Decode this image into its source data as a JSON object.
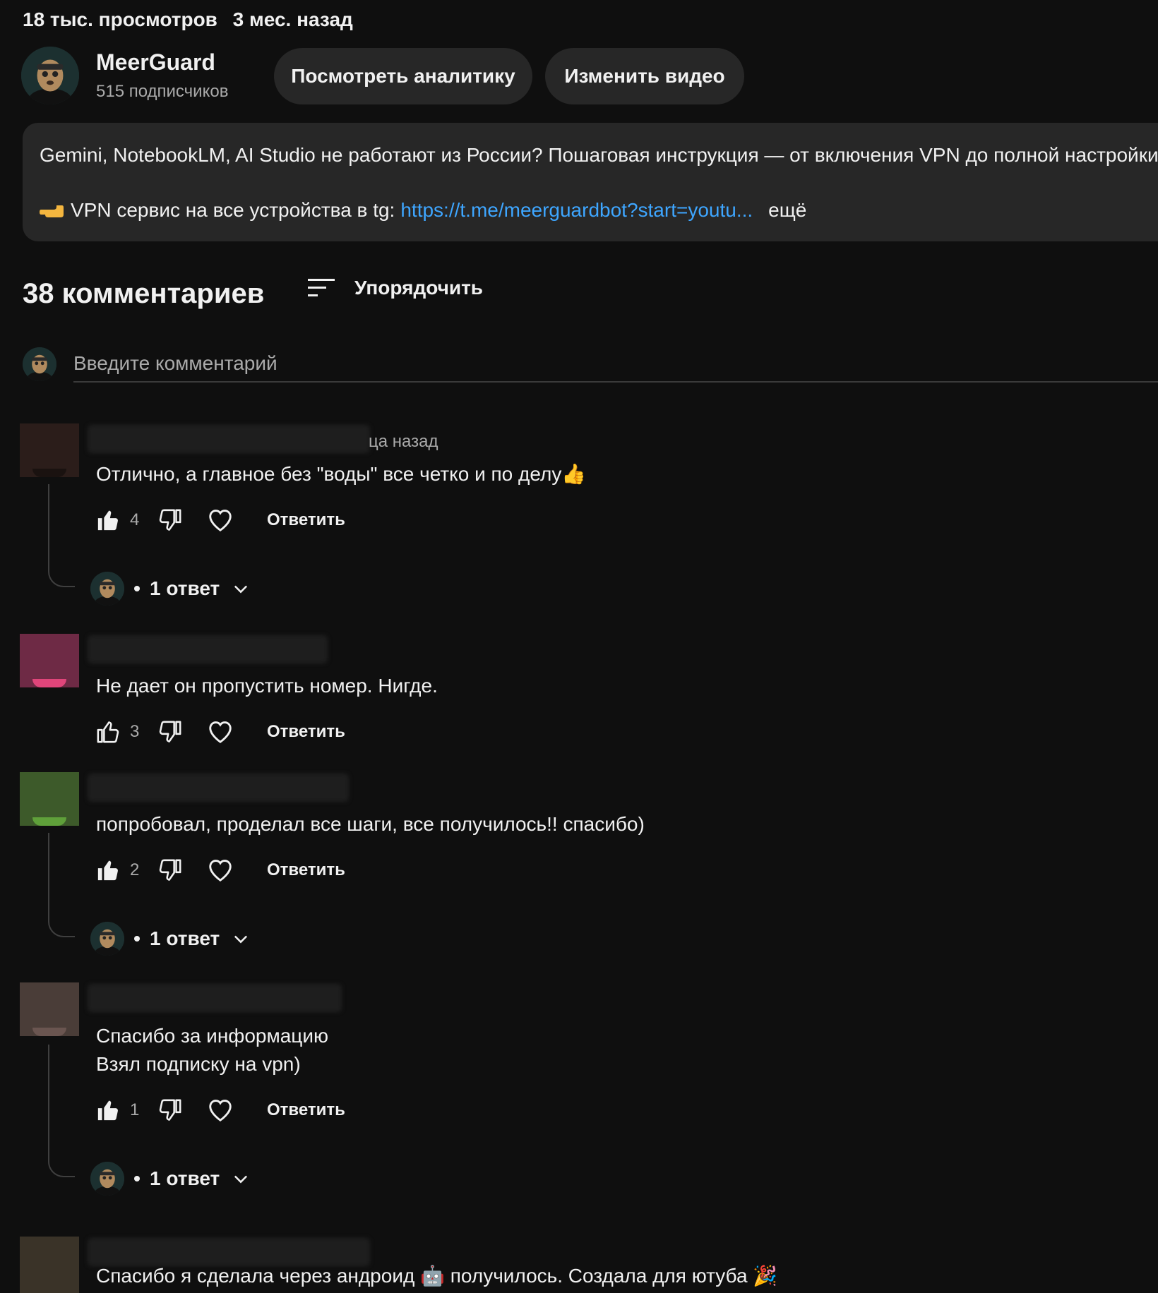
{
  "video": {
    "views": "18 тыс. просмотров",
    "age": "3 мес. назад"
  },
  "channel": {
    "name": "MeerGuard",
    "subscribers": "515 подписчиков",
    "avatar_icon": "meerkat-avatar"
  },
  "actions": {
    "analytics_label": "Посмотреть аналитику",
    "edit_label": "Изменить видео"
  },
  "description": {
    "line1": "Gemini, NotebookLM, AI Studio не работают из России? Пошаговая инструкция — от включения VPN до полной настройки",
    "line2_prefix": "VPN сервис на все устройства в tg:",
    "line2_emoji": "pointing-hand-icon",
    "link": "https://t.me/meerguardbot?start=youtu...",
    "more": "ещё"
  },
  "comments_header": {
    "count_label": "38 комментариев",
    "sort_label": "Упорядочить"
  },
  "comment_input": {
    "placeholder": "Введите комментарий"
  },
  "comments": [
    {
      "time": "ца назад",
      "text": "Отлично, а главное без \"воды\" все четко и по делу👍",
      "likes": "4",
      "reply_label": "Ответить",
      "replies_label": "1 ответ",
      "liked": true,
      "avatar_color": "#2b1d1a"
    },
    {
      "text": "Не дает он пропустить номер. Нигде.",
      "likes": "3",
      "reply_label": "Ответить",
      "liked": false,
      "avatar_color": "#6e2a45"
    },
    {
      "text": "попробовал, проделал все шаги, все получилось!! спасибо)",
      "likes": "2",
      "reply_label": "Ответить",
      "replies_label": "1 ответ",
      "liked": true,
      "avatar_color": "#3d5a2a"
    },
    {
      "text_line1": "Спасибо за информацию",
      "text_line2": "Взял подписку на vpn)",
      "likes": "1",
      "reply_label": "Ответить",
      "replies_label": "1 ответ",
      "liked": true,
      "avatar_color": "#4a3d38"
    },
    {
      "text": "Спасибо я сделала через андроид 🤖 получилось. Создала для ютуба 🎉",
      "avatar_color": "#3a3328"
    }
  ]
}
